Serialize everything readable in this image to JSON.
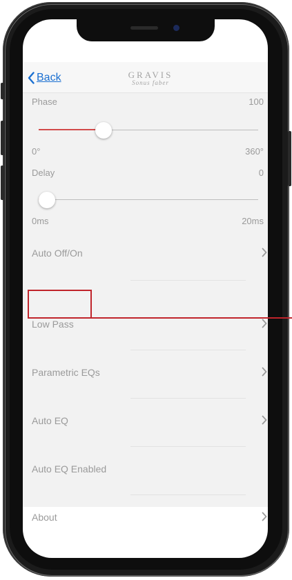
{
  "nav": {
    "back_label": "Back",
    "logo_title": "GRAVIS",
    "logo_subtitle": "Sonus faber"
  },
  "phase": {
    "label": "Phase",
    "value": "100",
    "min_label": "0°",
    "max_label": "360°",
    "slider_fraction": 0.28
  },
  "delay": {
    "label": "Delay",
    "value": "0",
    "min_label": "0ms",
    "max_label": "20ms",
    "slider_fraction": 0.0
  },
  "menu": [
    {
      "label": "Auto Off/On",
      "chevron": true
    },
    {
      "label": "Low Pass",
      "chevron": true
    },
    {
      "label": "Parametric EQs",
      "chevron": true
    },
    {
      "label": "Auto EQ",
      "chevron": true
    },
    {
      "label": "Auto EQ Enabled",
      "chevron": false
    },
    {
      "label": "About",
      "chevron": true
    }
  ],
  "colors": {
    "accent_blue": "#1a6fd1",
    "slider_fill_red": "#d24a4a",
    "annotation_red": "#c0242b"
  }
}
